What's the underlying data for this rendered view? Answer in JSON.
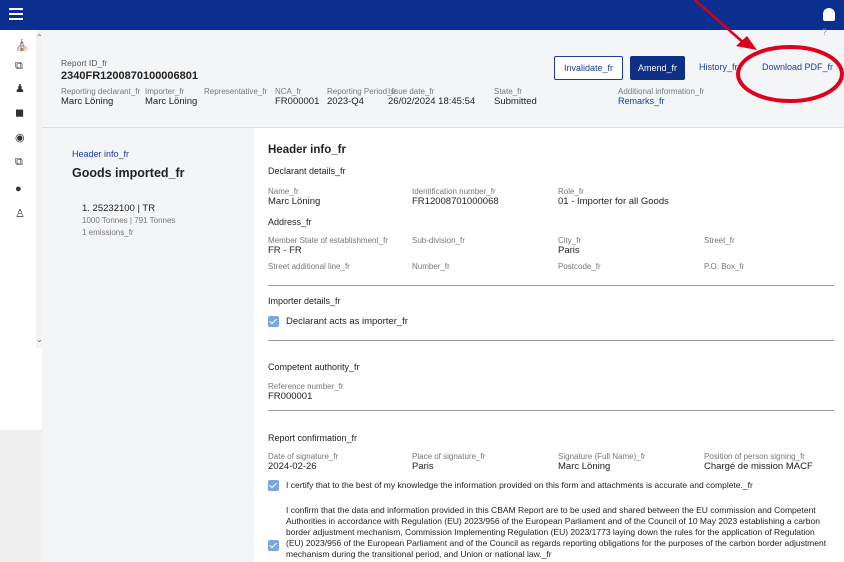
{
  "header": {
    "report_id_label": "Report ID_fr",
    "report_id": "2340FR1200870100006801",
    "fields": [
      {
        "label": "Reporting declarant_fr",
        "value": "Marc Löning"
      },
      {
        "label": "Importer_fr",
        "value": "Marc Löning"
      },
      {
        "label": "Representative_fr",
        "value": ""
      },
      {
        "label": "NCA_fr",
        "value": "FR000001"
      },
      {
        "label": "Reporting Period_fr",
        "value": "2023-Q4"
      },
      {
        "label": "Issue date_fr",
        "value": "26/02/2024 18:45:54"
      },
      {
        "label": "State_fr",
        "value": "Submitted"
      },
      {
        "label": "Additional information_fr",
        "value": "Remarks_fr"
      }
    ],
    "invalidate_label": "Invalidate_fr",
    "amend_label": "Amend_fr",
    "history_label": "History_fr",
    "download_label": "Download PDF_fr",
    "help_glyph": "?"
  },
  "side": {
    "header_link": "Header info_fr",
    "goods_title": "Goods imported_fr",
    "good_line1": "1. 25232100 | TR",
    "good_line2": "1000 Tonnes | 791 Tonnes",
    "good_line3": "1 emissions_fr"
  },
  "content": {
    "title": "Header info_fr",
    "declarant_section": "Declarant details_fr",
    "name_label": "Name_fr",
    "name_value": "Marc Löning",
    "idnum_label": "Identification number_fr",
    "idnum_value": "FR12008701000068",
    "role_label": "Role_fr",
    "role_value": "01 - Importer for all Goods",
    "address_section": "Address_fr",
    "member_state_label": "Member State of establishment_fr",
    "member_state_value": "FR - FR",
    "subdivision_label": "Sub-division_fr",
    "city_label": "City_fr",
    "city_value": "Paris",
    "street_label": "Street_fr",
    "street_add_label": "Street additional line_fr",
    "number_label": "Number_fr",
    "postcode_label": "Postcode_fr",
    "pobox_label": "P.O. Box_fr",
    "importer_section": "Importer details_fr",
    "declarant_importer": "Declarant acts as importer_fr",
    "competent_section": "Competent authority_fr",
    "refnum_label": "Reference number_fr",
    "refnum_value": "FR000001",
    "confirmation_section": "Report confirmation_fr",
    "date_sig_label": "Date of signature_fr",
    "date_sig_value": "2024-02-26",
    "place_sig_label": "Place of signature_fr",
    "place_sig_value": "Paris",
    "sig_name_label": "Signature (Full Name)_fr",
    "sig_name_value": "Marc Löning",
    "position_label": "Position of person signing_fr",
    "position_value": "Chargé de mission MACF",
    "certify_text": "I certify that to the best of my knowledge the information provided on this form and attachments is accurate and complete._fr",
    "confirm_text": "I confirm that the data and information provided in this CBAM Report are to be used and shared between the EU commission and Competent Authorities in accordance with Regulation (EU) 2023/956 of the European Parliament and of the Council of 10 May 2023 establishing a carbon border adjustment mechanism, Commission Implementing Regulation (EU) 2023/1773 laying down the rules for the application of Regulation (EU) 2023/956 of the European Parliament and of the Council as regards reporting obligations for the purposes of the carbon border adjustment mechanism during the transitional period, and Union or national law._fr"
  },
  "nav_icons": [
    "home-icon",
    "copy-icon",
    "users-icon",
    "briefcase-icon",
    "user-circle-icon",
    "copy-icon",
    "chat-icon",
    "person-icon"
  ],
  "colors": {
    "topbar": "#0b2f8e",
    "primary": "#0d2f85",
    "annotation": "#e0001b",
    "checkbox": "#7aa6e0"
  }
}
